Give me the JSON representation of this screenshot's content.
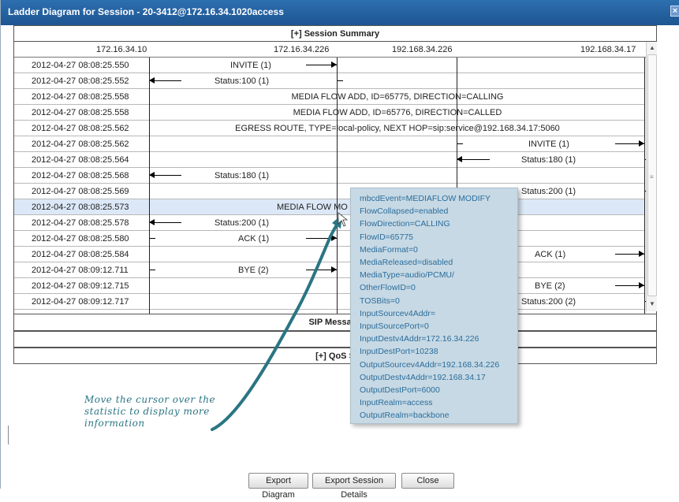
{
  "window": {
    "title": "Ladder Diagram for Session - 20-3412@172.16.34.1020access",
    "close_glyph": "×"
  },
  "session_summary_label": "[+] Session Summary",
  "hosts": [
    "172.16.34.10",
    "172.16.34.226",
    "192.168.34.226",
    "192.168.34.17"
  ],
  "rows": [
    {
      "ts": "2012-04-27 08:08:25.550",
      "label": "INVITE (1)"
    },
    {
      "ts": "2012-04-27 08:08:25.552",
      "label": "Status:100 (1)"
    },
    {
      "ts": "2012-04-27 08:08:25.558",
      "label": "MEDIA FLOW ADD, ID=65775, DIRECTION=CALLING"
    },
    {
      "ts": "2012-04-27 08:08:25.558",
      "label": "MEDIA FLOW ADD, ID=65776, DIRECTION=CALLED"
    },
    {
      "ts": "2012-04-27 08:08:25.562",
      "label": "EGRESS ROUTE, TYPE=local-policy, NEXT HOP=sip:service@192.168.34.17:5060"
    },
    {
      "ts": "2012-04-27 08:08:25.562",
      "label": "INVITE (1)"
    },
    {
      "ts": "2012-04-27 08:08:25.564",
      "label": "Status:180 (1)"
    },
    {
      "ts": "2012-04-27 08:08:25.568",
      "label": "Status:180 (1)"
    },
    {
      "ts": "2012-04-27 08:08:25.569",
      "label": "Status:200 (1)"
    },
    {
      "ts": "2012-04-27 08:08:25.573",
      "label": "MEDIA FLOW MO"
    },
    {
      "ts": "2012-04-27 08:08:25.578",
      "label": "Status:200 (1)"
    },
    {
      "ts": "2012-04-27 08:08:25.580",
      "label": "ACK (1)"
    },
    {
      "ts": "2012-04-27 08:08:25.584",
      "label": "ACK (1)"
    },
    {
      "ts": "2012-04-27 08:09:12.711",
      "label": "BYE (2)"
    },
    {
      "ts": "2012-04-27 08:09:12.715",
      "label": "BYE (2)"
    },
    {
      "ts": "2012-04-27 08:09:12.717",
      "label": "Status:200 (2)"
    }
  ],
  "sip_messages_label": "SIP Message",
  "qos_label": "[+] QoS S",
  "tooltip_lines": [
    "mbcdEvent=MEDIAFLOW MODIFY",
    "FlowCollapsed=enabled",
    "FlowDirection=CALLING",
    "FlowID=65775",
    "MediaFormat=0",
    "MediaReleased=disabled",
    "MediaType=audio/PCMU/",
    "OtherFlowID=0",
    "TOSBits=0",
    "InputSourcev4Addr=",
    "InputSourcePort=0",
    "InputDestv4Addr=172.16.34.226",
    "InputDestPort=10238",
    "OutputSourcev4Addr=192.168.34.226",
    "OutputDestv4Addr=192.168.34.17",
    "OutputDestPort=6000",
    "InputRealm=access",
    "OutputRealm=backbone"
  ],
  "annotation": "Move the cursor over the statistic to display more information",
  "buttons": {
    "export_diagram": "Export Diagram",
    "export_session": "Export Session Details",
    "close": "Close"
  },
  "colors": {
    "titlebar": "#1d5591",
    "tooltip_bg": "#c7d9e4",
    "tooltip_text": "#2a6d9c",
    "annotation": "#2a7583",
    "selected_row": "#dce8f7"
  }
}
